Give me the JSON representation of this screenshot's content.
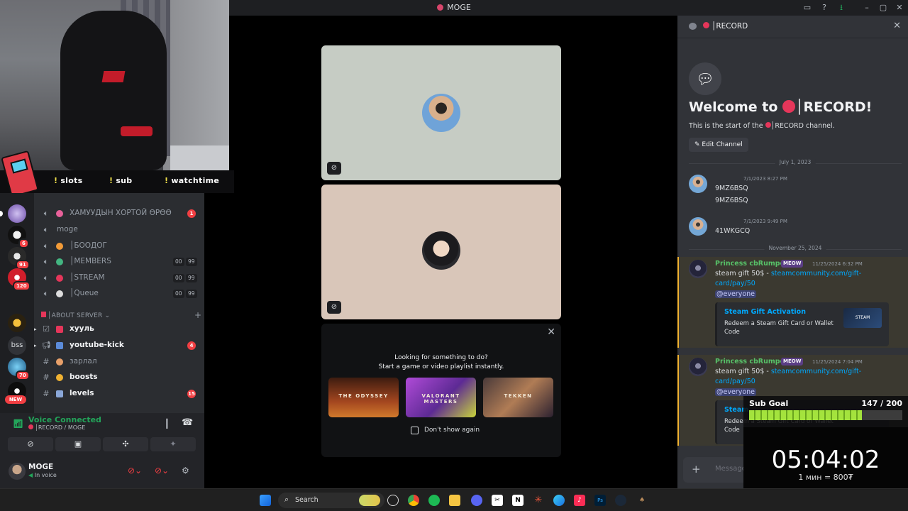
{
  "window": {
    "title": "MOGE"
  },
  "stream_overlay": {
    "commands": [
      "slots",
      "sub",
      "watchtime"
    ],
    "sub_goal": {
      "label": "Sub Goal",
      "value": "147 / 200",
      "progress": 0.735
    },
    "timer": {
      "time": "05:04:02",
      "rate": "1 мин = 800₮"
    }
  },
  "servers": [
    {
      "name": "bss"
    },
    {
      "badge": "6"
    },
    {
      "badge": "91"
    },
    {
      "badge": "120"
    },
    {
      "badge": "70"
    },
    {
      "badge": "NEW"
    }
  ],
  "channels": {
    "voice": [
      {
        "name": "ХАМУУДЫН ХОРТОЙ ӨРӨӨ",
        "emoji_color": "#e8619a",
        "badge": "1"
      },
      {
        "name": "moge"
      },
      {
        "name": "│БООДОГ",
        "emoji_color": "#f29b38"
      },
      {
        "name": "│MEMBERS",
        "emoji_color": "#43b581",
        "count_a": "00",
        "count_b": "99"
      },
      {
        "name": "│STREAM",
        "emoji_color": "#e5365a",
        "count_a": "00",
        "count_b": "99"
      },
      {
        "name": "│Queue",
        "emoji_color": "#dddddd",
        "count_a": "00",
        "count_b": "99"
      }
    ],
    "section": "│ABOUT SERVER",
    "text": [
      {
        "name": "хууль",
        "emoji_color": "#e5365a",
        "bold": true
      },
      {
        "name": "youtube-kick",
        "emoji_color": "#5b8bd9",
        "bold": true,
        "badge": "4"
      },
      {
        "name": "зарлал",
        "emoji_color": "#e8a06a"
      },
      {
        "name": "boosts",
        "emoji_color": "#f0b232",
        "bold": true
      },
      {
        "name": "levels",
        "emoji_color": "#8aa7d8",
        "bold": true,
        "badge": "15"
      }
    ]
  },
  "voice_panel": {
    "status": "Voice Connected",
    "location": "│RECORD / MOGE",
    "user": {
      "name": "MOGE",
      "status": "In voice"
    }
  },
  "activity": {
    "heading_line1": "Looking for something to do?",
    "heading_line2": "Start a game or video playlist instantly.",
    "cards": [
      "THE ODYSSEY",
      "VALORANT MASTERS",
      "TEKKEN"
    ],
    "checkbox_label": "Don't show again"
  },
  "chat": {
    "channel": "│RECORD",
    "welcome_title": "Welcome to",
    "welcome_channel": "│RECORD!",
    "welcome_sub_prefix": "This is the start of the",
    "welcome_sub_channel": "│RECORD",
    "welcome_sub_suffix": "channel.",
    "edit_button": "Edit Channel",
    "date1": "July 1, 2023",
    "date2": "November 25, 2024",
    "messages": [
      {
        "author": "",
        "time": "7/1/2023 8:27 PM",
        "lines": [
          "9MZ6BSQ",
          "9MZ6BSQ"
        ]
      },
      {
        "author": "",
        "time": "7/1/2023 9:49 PM",
        "lines": [
          "41WKGCQ"
        ]
      },
      {
        "author": "Princess cbRumpel",
        "tag": "MEOW",
        "time": "11/25/2024 6:32 PM",
        "text": "steam gift 50$ - ",
        "link1": "steamcommunity.com/gift-",
        "link2": "card/pay/50",
        "mention": "@everyone",
        "embed_title": "Steam Gift Activation",
        "embed_desc": "Redeem a Steam Gift Card or Wallet Code",
        "thumb_label": "STEAM"
      },
      {
        "author": "Princess cbRumpel",
        "tag": "MEOW",
        "time": "11/25/2024 7:04 PM",
        "text": "steam gift 50$ - ",
        "link1": "steamcommunity.com/gift-",
        "link2": "card/pay/50",
        "mention": "@everyone",
        "embed_title": "Steam",
        "embed_desc": "Redeem a Steam Gift Card or Wallet Code"
      }
    ],
    "composer_placeholder": "Message"
  },
  "taskbar": {
    "search_label": "Search"
  }
}
